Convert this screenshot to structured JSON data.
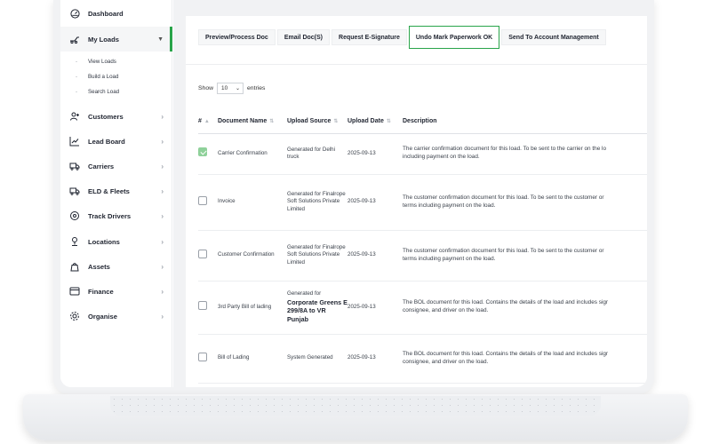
{
  "sidebar": {
    "items": [
      {
        "label": "Dashboard",
        "icon": "dashboard-icon"
      },
      {
        "label": "My Loads",
        "icon": "truck-ramp-icon",
        "active": true
      },
      {
        "label": "Customers",
        "icon": "add-user-icon"
      },
      {
        "label": "Lead Board",
        "icon": "chart-trend-icon"
      },
      {
        "label": "Carriers",
        "icon": "truck-icon"
      },
      {
        "label": "ELD & Fleets",
        "icon": "fleet-truck-icon"
      },
      {
        "label": "Track Drivers",
        "icon": "location-pin-icon"
      },
      {
        "label": "Locations",
        "icon": "map-pin-icon"
      },
      {
        "label": "Assets",
        "icon": "bag-icon"
      },
      {
        "label": "Finance",
        "icon": "wallet-icon"
      },
      {
        "label": "Organise",
        "icon": "gear-icon"
      }
    ],
    "sub_items": [
      "View Loads",
      "Build a Load",
      "Search Load"
    ]
  },
  "toolbar": {
    "buttons": [
      "Preview/Process Doc",
      "Email Doc(S)",
      "Request E-Signature",
      "Undo Mark Paperwork OK",
      "Send To Account Management"
    ]
  },
  "table_controls": {
    "show_label": "Show",
    "entries_value": "10",
    "entries_label": "entries"
  },
  "table": {
    "headers": [
      "#",
      "Document Name",
      "Upload Source",
      "Upload Date",
      "Description"
    ],
    "rows": [
      {
        "checked": true,
        "name": "Carrier Confirmation",
        "source": "Generated for Delhi truck",
        "date": "2025-09-13",
        "desc1": "The carrier confirmation document for this load. To be sent to the carrier on the lo",
        "desc2": "including payment on the load."
      },
      {
        "checked": false,
        "name": "Invoice",
        "source": "Generated for Finalrope Soft Solutions Private Limited",
        "date": "2025-09-13",
        "desc1": "The customer confirmation document for this load. To be sent to the customer or",
        "desc2": "terms including payment on the load."
      },
      {
        "checked": false,
        "name": "Customer Confirmation",
        "source": "Generated for Finalrope Soft Solutions Private Limited",
        "date": "2025-09-13",
        "desc1": "The customer confirmation document for this load. To be sent to the customer or",
        "desc2": "terms including payment on the load."
      },
      {
        "checked": false,
        "name": "3rd Party Bill of lading",
        "source_small": "Generated for",
        "source_big": "Corporate Greens E 299/8A to VR Punjab",
        "date": "2025-09-13",
        "desc1": "The BOL document for this load. Contains the details of the load and includes sigr",
        "desc2": "consignee, and driver on the load."
      },
      {
        "checked": false,
        "name": "Bill of Lading",
        "source": "System Generated",
        "date": "2025-09-13",
        "desc1": "The BOL document for this load. Contains the details of the load and includes sigr",
        "desc2": "consignee, and driver on the load."
      }
    ]
  },
  "colors": {
    "accent": "#29a44a",
    "checked": "#8fd19a",
    "background": "#f1f2f4"
  }
}
